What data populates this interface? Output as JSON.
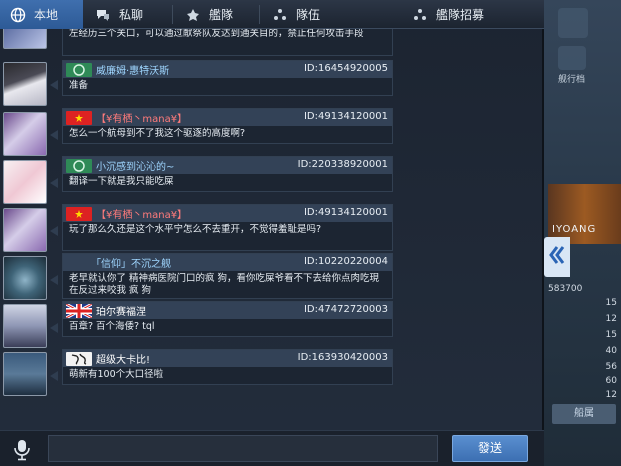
{
  "tabs": [
    {
      "label": "本地",
      "icon": "globe-icon",
      "active": true
    },
    {
      "label": "私聊",
      "icon": "chat-bubble-icon",
      "active": false
    },
    {
      "label": "艦隊",
      "icon": "fleet-emblem-icon",
      "active": false
    },
    {
      "label": "隊伍",
      "icon": "team-dots-icon",
      "active": false
    },
    {
      "label": "艦隊招募",
      "icon": "recruit-dots-icon",
      "active": false
    }
  ],
  "partial_message": {
    "text": "剧，游戏开始后dd可以往中间移动，可以做出一些关口阻挡，dd将从右到左经历三个关口，可以通过献祭队友达到通关目的，禁止任何攻击手段"
  },
  "messages": [
    {
      "name": "威廉姆·惠特沃斯",
      "uid": "ID:16454920005",
      "text": "准备",
      "name_color": "#9fd6ff",
      "flag": "green-badge"
    },
    {
      "name": "【¥有栖丶mana¥】",
      "uid": "ID:49134120001",
      "text": "怎么一个航母到不了我这个驱逐的高度啊?",
      "name_color": "#ff7b7b",
      "flag": "prc-flag"
    },
    {
      "name": "小沉感到沁沁的~",
      "uid": "ID:220338920001",
      "text": "翻译一下就是我只能吃屎",
      "name_color": "#9fd6ff",
      "flag": "green-badge"
    },
    {
      "name": "【¥有栖丶mana¥】",
      "uid": "ID:49134120001",
      "text": "玩了那么久还是这个水平宁怎么不去重开，不觉得羞耻是吗?",
      "name_color": "#ff7b7b",
      "flag": "prc-flag"
    },
    {
      "name": "「信仰」不沉之舰",
      "uid": "ID:10220220004",
      "text": "老早就认你了 精神病医院门口的疯 狗，看你吃屎爷看不下去给你点肉吃現在反过来咬我 疯 狗",
      "name_color": "#9fd6ff",
      "flag": "none"
    },
    {
      "name": "珀尔赛福涅",
      "uid": "ID:47472720003",
      "text": "百章? 百个海倭? tql",
      "name_color": "#ffffff",
      "flag": "uk-flag"
    },
    {
      "name": "超级大卡比!",
      "uid": "ID:163930420003",
      "text": "萌新有100个大口径啦",
      "name_color": "#ffffff",
      "flag": "calligraphy-badge"
    }
  ],
  "input": {
    "placeholder": "",
    "value": ""
  },
  "send_label": "發送",
  "colors": {
    "accent": "#3c6fb2",
    "tab_active": "#3f6fae",
    "bubble_head": "#334257"
  },
  "backdrop": {
    "labels": [
      "舰行档"
    ],
    "banner_text": "IYOANG",
    "stats": [
      "583700",
      "15",
      "12",
      "15",
      "40",
      "56",
      "60",
      "12"
    ],
    "button_label": "船属"
  }
}
